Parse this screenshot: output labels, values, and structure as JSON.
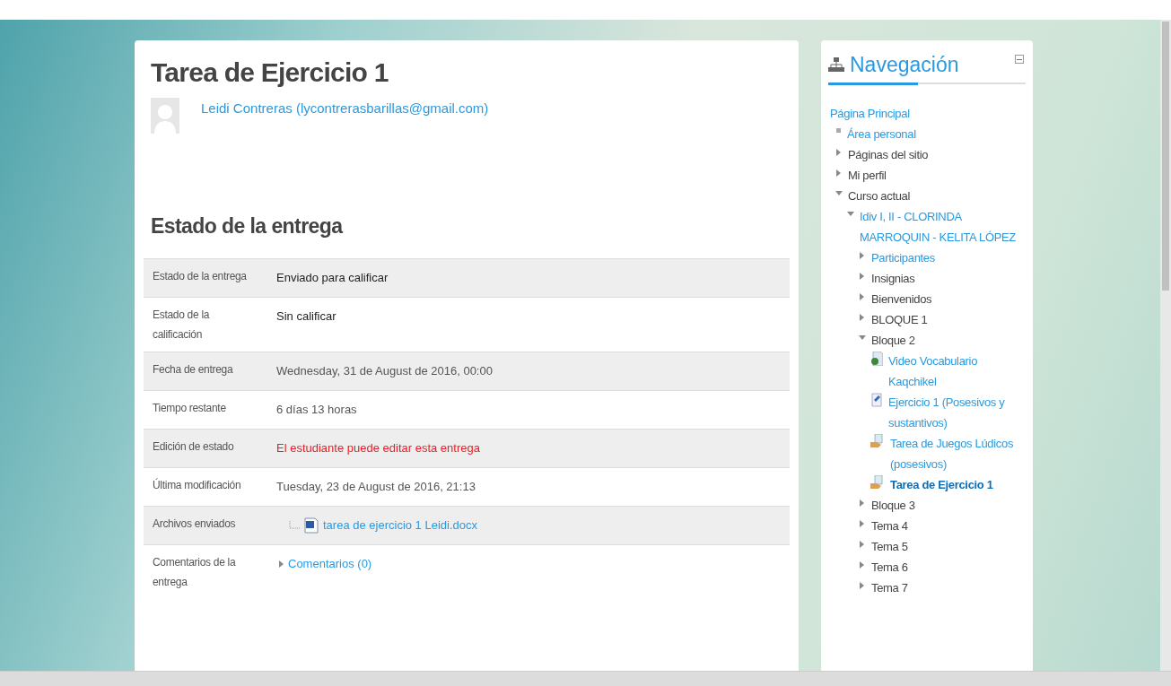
{
  "page": {
    "title": "Tarea de Ejercicio 1",
    "user": {
      "name": "Leidi Contreras (lycontrerasbarillas@gmail.com)"
    }
  },
  "submission": {
    "heading": "Estado de la entrega",
    "rows": [
      {
        "label": "Estado de la entrega",
        "value": "Enviado para calificar",
        "kind": "text"
      },
      {
        "label": "Estado de la calificación",
        "value": "Sin calificar",
        "kind": "text"
      },
      {
        "label": "Fecha de entrega",
        "value": "Wednesday, 31 de August de 2016, 00:00",
        "kind": "muted"
      },
      {
        "label": "Tiempo restante",
        "value": "6 días 13 horas",
        "kind": "muted"
      },
      {
        "label": "Edición de estado",
        "value": "El estudiante puede editar esta entrega",
        "kind": "alert"
      },
      {
        "label": "Última modificación",
        "value": "Tuesday, 23 de August de 2016, 21:13",
        "kind": "muted"
      },
      {
        "label": "Archivos enviados",
        "value": "tarea de ejercicio 1 Leidi.docx",
        "kind": "file"
      },
      {
        "label": "Comentarios de la entrega",
        "value": "Comentarios (0)",
        "kind": "comments"
      }
    ]
  },
  "navigation": {
    "title": "Navegación",
    "items": [
      {
        "label": "Página Principal",
        "kind": "root",
        "link": true,
        "selected": false,
        "children": [
          {
            "label": "Área personal",
            "kind": "leaf",
            "link": true,
            "selected": false
          },
          {
            "label": "Páginas del sitio",
            "kind": "branch",
            "expanded": false,
            "link": false,
            "selected": false
          },
          {
            "label": "Mi perfil",
            "kind": "branch",
            "expanded": false,
            "link": false,
            "selected": false
          },
          {
            "label": "Curso actual",
            "kind": "branch",
            "expanded": true,
            "link": false,
            "selected": false,
            "children": [
              {
                "label": "Idiv I, II - CLORINDA MARROQUIN - KELITA LÓPEZ",
                "kind": "branch",
                "expanded": true,
                "link": true,
                "selected": false,
                "children": [
                  {
                    "label": "Participantes",
                    "kind": "branch",
                    "expanded": false,
                    "link": true,
                    "selected": false
                  },
                  {
                    "label": "Insignias",
                    "kind": "branch",
                    "expanded": false,
                    "link": false,
                    "selected": false
                  },
                  {
                    "label": "Bienvenidos",
                    "kind": "branch",
                    "expanded": false,
                    "link": false,
                    "selected": false
                  },
                  {
                    "label": "BLOQUE 1",
                    "kind": "branch",
                    "expanded": false,
                    "link": false,
                    "selected": false
                  },
                  {
                    "label": "Bloque 2",
                    "kind": "branch",
                    "expanded": true,
                    "link": false,
                    "selected": false,
                    "children": [
                      {
                        "label": "Video Vocabulario Kaqchikel",
                        "kind": "resource",
                        "link": true,
                        "selected": false
                      },
                      {
                        "label": "Ejercicio 1 (Posesivos y sustantivos)",
                        "kind": "quiz",
                        "link": true,
                        "selected": false
                      },
                      {
                        "label": "Tarea de Juegos Lúdicos (posesivos)",
                        "kind": "assignment",
                        "link": true,
                        "selected": false
                      },
                      {
                        "label": "Tarea de Ejercicio 1",
                        "kind": "assignment",
                        "link": true,
                        "selected": true
                      }
                    ]
                  },
                  {
                    "label": "Bloque 3",
                    "kind": "branch",
                    "expanded": false,
                    "link": false,
                    "selected": false
                  },
                  {
                    "label": "Tema 4",
                    "kind": "branch",
                    "expanded": false,
                    "link": false,
                    "selected": false
                  },
                  {
                    "label": "Tema 5",
                    "kind": "branch",
                    "expanded": false,
                    "link": false,
                    "selected": false
                  },
                  {
                    "label": "Tema 6",
                    "kind": "branch",
                    "expanded": false,
                    "link": false,
                    "selected": false
                  },
                  {
                    "label": "Tema 7",
                    "kind": "branch",
                    "expanded": false,
                    "link": false,
                    "selected": false
                  }
                ]
              }
            ]
          }
        ]
      }
    ]
  }
}
